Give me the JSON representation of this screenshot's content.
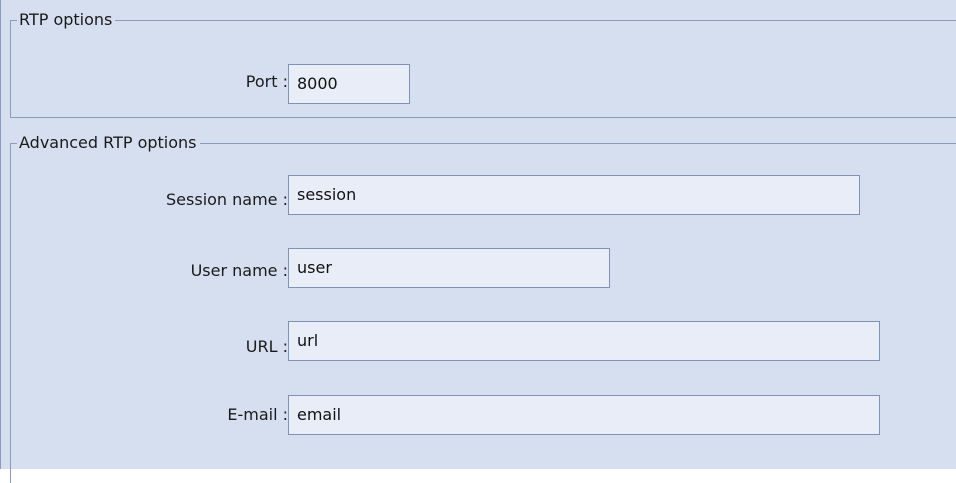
{
  "rtp_options": {
    "title": "RTP options",
    "port": {
      "label": "Port :",
      "value": "8000"
    }
  },
  "advanced_rtp_options": {
    "title": "Advanced RTP options",
    "session_name": {
      "label": "Session name :",
      "value": "session"
    },
    "user_name": {
      "label": "User name :",
      "value": "user"
    },
    "url": {
      "label": "URL :",
      "value": "url"
    },
    "email": {
      "label": "E-mail :",
      "value": "email"
    }
  },
  "colors": {
    "panel_background": "#d6dff0",
    "group_border": "#8a9bbd",
    "field_background": "#e8edf8",
    "field_border": "#7f93b8"
  }
}
